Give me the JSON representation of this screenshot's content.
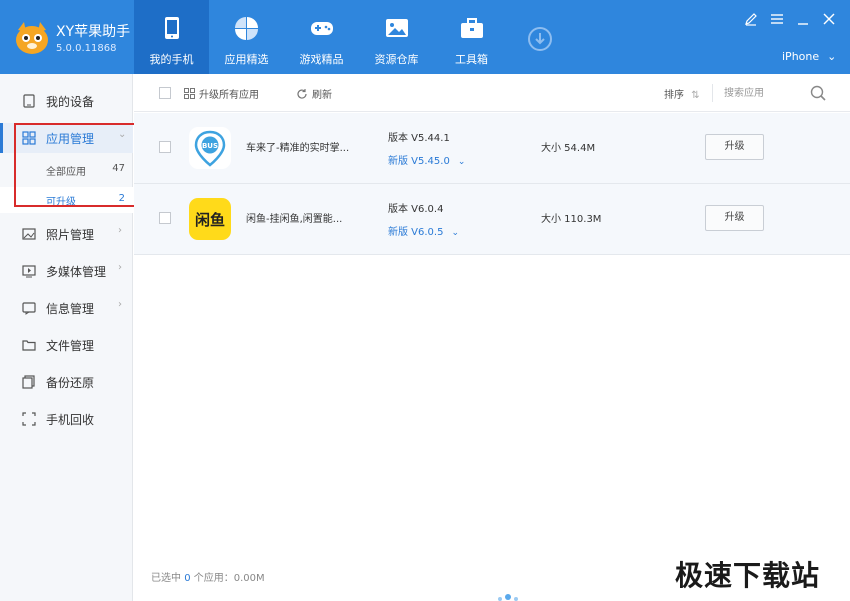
{
  "app": {
    "title": "XY苹果助手",
    "version": "5.0.0.11868"
  },
  "nav": [
    {
      "label": "我的手机",
      "icon": "phone-icon"
    },
    {
      "label": "应用精选",
      "icon": "apps-grid-icon"
    },
    {
      "label": "游戏精品",
      "icon": "gamepad-icon"
    },
    {
      "label": "资源仓库",
      "icon": "image-icon"
    },
    {
      "label": "工具箱",
      "icon": "toolbox-icon"
    }
  ],
  "device": {
    "name": "iPhone"
  },
  "sidebar": {
    "items": [
      {
        "label": "我的设备",
        "icon": "device-icon"
      },
      {
        "label": "应用管理",
        "icon": "app-grid-icon"
      },
      {
        "label": "照片管理",
        "icon": "photo-icon"
      },
      {
        "label": "多媒体管理",
        "icon": "media-icon"
      },
      {
        "label": "信息管理",
        "icon": "message-icon"
      },
      {
        "label": "文件管理",
        "icon": "folder-icon"
      },
      {
        "label": "备份还原",
        "icon": "backup-icon"
      },
      {
        "label": "手机回收",
        "icon": "recycle-icon"
      }
    ],
    "sub": [
      {
        "label": "全部应用",
        "count": "47"
      },
      {
        "label": "可升级",
        "count": "2"
      }
    ]
  },
  "toolbar": {
    "upgrade_all": "升级所有应用",
    "refresh": "刷新",
    "sort": "排序",
    "search_placeholder": "搜索应用"
  },
  "apps": [
    {
      "name": "车来了-精准的实时掌...",
      "version": "版本 V5.44.1",
      "new_version": "新版 V5.45.0",
      "size": "大小 54.4M",
      "action": "升级",
      "icon": "bus-app-icon",
      "icon_text": "BUS"
    },
    {
      "name": "闲鱼-挂闲鱼,闲置能...",
      "version": "版本 V6.0.4",
      "new_version": "新版 V6.0.5",
      "size": "大小 110.3M",
      "action": "升级",
      "icon": "xianyu-app-icon",
      "icon_text": "闲鱼"
    }
  ],
  "status": {
    "prefix": "已选中",
    "count": "0",
    "suffix": "个应用：0.00M"
  },
  "watermark": {
    "text": "极速下载站"
  },
  "colors": {
    "header": "#2f86dd",
    "accent": "#2a7ad6",
    "highlight": "#d82b2b"
  }
}
